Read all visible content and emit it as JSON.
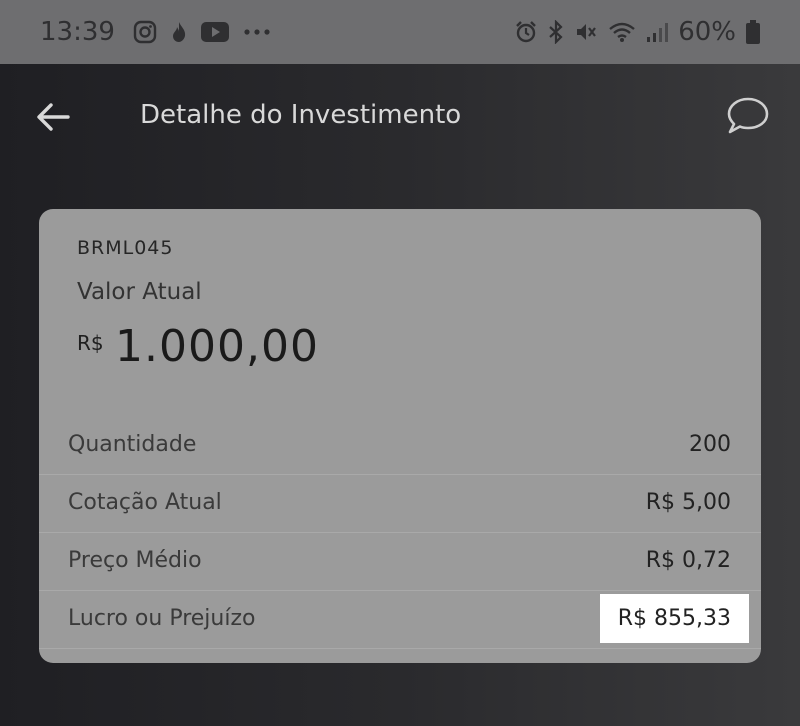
{
  "status_bar": {
    "time": "13:39",
    "left_icons": [
      "instagram-icon",
      "flame-icon",
      "youtube-icon",
      "more-icon"
    ],
    "right_icons": [
      "alarm-icon",
      "bluetooth-icon",
      "mute-icon",
      "wifi-icon",
      "signal-icon",
      "battery-icon"
    ],
    "battery_percent": "60%"
  },
  "header": {
    "title": "Detalhe do Investimento",
    "back_icon": "arrow-left-icon",
    "chat_icon": "chat-bubble-icon"
  },
  "card": {
    "ticker": "BRML045",
    "current_value_label": "Valor Atual",
    "currency_symbol": "R$",
    "current_value": "1.000,00",
    "rows": [
      {
        "label": "Quantidade",
        "value": "200"
      },
      {
        "label": "Cotação Atual",
        "value": "R$ 5,00"
      },
      {
        "label": "Preço Médio",
        "value": "R$ 0,72"
      },
      {
        "label": "Lucro ou Prejuízo",
        "value": "R$ 855,33"
      }
    ]
  },
  "colors": {
    "status_bar_bg": "#6e6e70",
    "card_bg": "#9b9b9b",
    "highlight_bg": "#ffffff"
  }
}
